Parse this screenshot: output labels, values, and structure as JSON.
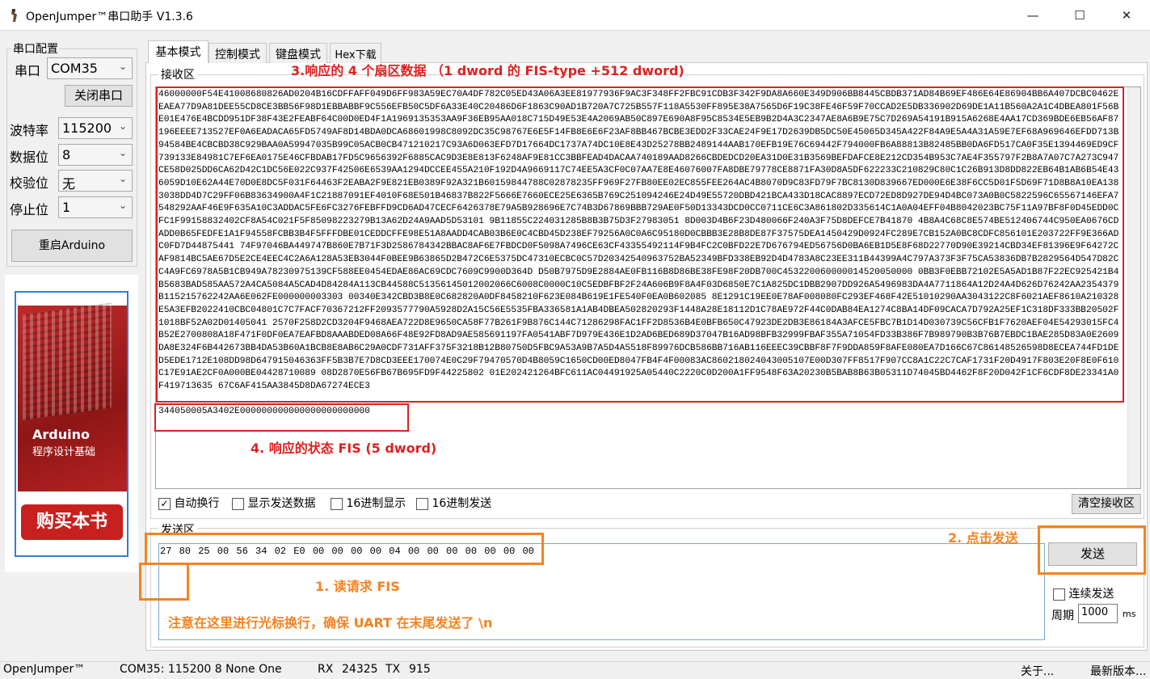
{
  "window": {
    "title": "OpenJumper™串口助手  V1.3.6",
    "controls": {
      "minimize": "—",
      "maximize": "☐",
      "close": "✕"
    }
  },
  "left_panel": {
    "group_title": "串口配置",
    "port_label": "串口",
    "port_value": "COM35",
    "close_port_button": "关闭串口",
    "baud_label": "波特率",
    "baud_value": "115200",
    "databits_label": "数据位",
    "databits_value": "8",
    "parity_label": "校验位",
    "parity_value": "无",
    "stopbits_label": "停止位",
    "stopbits_value": "1",
    "restart_button": "重启Arduino",
    "ad": {
      "book_title": "Arduino",
      "book_subtitle": "程序设计基础",
      "buy_button": "购买本书"
    }
  },
  "tabs": [
    {
      "label": "基本模式",
      "active": true
    },
    {
      "label": "控制模式",
      "active": false
    },
    {
      "label": "键盘模式",
      "active": false
    },
    {
      "label": "Hex下载",
      "active": false
    }
  ],
  "receive": {
    "group_title": "接收区",
    "hex_data": "46000000F54E41008680826AD0204B16CDFFAFF049D6FF983A59EC70A4DF782C05ED43A06A3EE81977936F9AC3F348FF2FBC91CDB3F342F9DA8A660E349D906BB8445CBDB371AD84B69EF486E64E86904BB6A407DCBC0462EEAEA77D9A81DEE55CD8CE3BB56F98D1EBBABBF9C556EFB50C5DF6A33E40C20486D6F1863C90AD1B720A7C725B557F118A5530FF895E38A7565D6F19C38FE46F59F70CCAD2E5DB336902D69DE1A11B560A2A1C4DBEA801F56BE01E476E4BCDD951DF38F43E2FEABF64C00D0ED4F1A1969135353AA9F36EB95AA018C715D49E53E4A2069AB50C897E690A8F95C8534E5EB9B2D4A3C2347AE8A6B9E75C7D269A54191B915A6268E4AA17CD369BDE6EB56AF87196EEEE713527EF0A6EADACA65FD5749AF8D14BDA0DCA68601998C8092DC35C98767E6E5F14FB8E6E6F23AF8BB467BCBE3EDD2F33CAE24F9E17D2639DB5DC50E45065D345A422F84A9E5A4A31A59E7EF68A969646EFDD713B94584BE4CBCBD38C929BAA0A59947035B99C05ACB0CB471210217C93A6D063EFD7D17664DC1737A74DC10E8E43D25278BB2489144AAB170EFB19E76C69442F794000FB6A88813B82485BB0DA6FD517CA0F35E1394469ED9CF739133E84981C7EF6EA0175E46CFBDAB17FD5C9656392F6885CAC9D3E8E813F6248AF9E81CC3BBFEAD4DACAA740189AAD8266CBDEDCD20EA31D0E31B3569BEFDAFCE8E212CD354B953C7AE4F355797F2B8A7A07C7A273C947CE58D025DD6CA62D42C1DC56E022C937F42506E6539AA1294DCCEE455A210F192D4A9669117C74EE5A3CF0C07AA7E8E46076007FA8DBE79778CE8871FA30D8A5DF622233C210829C80C1C26B913D8DD822EB64B1AB6B54E436059D10E62A44E70D0E8DC5F031F64463F2EABA2F9E821EB0389F92A321B60159844788C02878235FF969F27FB80EE02EC855FEE264AC4B8070D9C83FD79F7BC8130D839667ED000E6E38F6CC5D01F5D69F71D8B8A10EA1383038DD4D7C29FF06B83634900A4F1C21887091EF4010F68E501B46837B822F5666E7660ECE25E6365B769C251094246E24D49E55720DBD421BCA433D18CAC8897ECD72ED8D927DE94D4BC073A0B0C5822596C65567146EFA7548292AAF46E9F635A10C3ADDAC5FE6FC3276FEBFFD9CD6AD47CECF6426378E79A5B928696E7C74B3D67869BBB729AE0F50D13343DCD0CC0711CE6C3A861802D335614C1A0A04EFF04B8042023BC75F11A97BF8F0D45EDD0CFC1F99158832402CF8A54C021F5F85098223279B13A62D24A9AAD5D53101 9B11855C224031285B8B3B75D3F27983051 8D003D4B6F23D480066F240A3F75D8DEFCE7B41870 4B8A4C68C8E574BE512406744C950EA0676CDADD0B65FEDFE1A1F94558FCBB3B4F5FFFDBE01CEDDCFFE98E51A8AADD4CAB03B6E0C4CBD45D238EF79256A0C0A6C95180D0CBBB3E28B8DE87F37575DEA1450429D0924FC289E7CB152A0BC8CDFC856101E203722FF9E366ADC0FD7D44875441 74F97046BA449747B860E7B71F3D2586784342BBAC8AF6E7FBDCD0F5098A7496CE63CF43355492114F9B4FC2C0BFD22E7D676794ED56756D0BA6EB1D5E8F68D22770D90E39214CBD34EF81396E9F64272CAF9814BC5AE67D5E2CE4EEC4C2A6A128A53EB3044F0BEE9B63865D2B472C6E5375DC47310ECBC0C57D20342540963752BA52349BFD338EB92D4D4783A8C23EE311B44399A4C797A373F3F75CA53836DB7B2829564D547D82CC4A9FC6978A5B1CB949A78230975139CF588EE0454EDAE86AC69CDC7609C9900D364D D50B7975D9E2884AE0FB116B8D86BE38FE98F20DB700C453220060000014520050000 0BB3F0EBB72102E5A5AD1B87F22EC925421B4B5683BAD585AA572A4CA5084A5CAD4D84284A113CB44588C51356145012002066C6008C0000C10C5EDBFBF2F24A606B9F8A4F03D6850E7C1A825DC1DBB2907DD926A5496983DA4A7711864A12D24A4D626D76242AA2354379B115215762242AA6E062FE000000003303 00340E342CBD3B8E0C682820A0DF8458210F623E084B619E1FE540F0EA0B602085 8E1291C19EE0E78AF008080FC293EF468F42E51010290AA3043122C8F6021AEF8610A210328E5A3EFB2022410CBC04801C7C7FACF70367212FF2093577790A5928D2A15C56E5535FBA336581A1AB4DBEA502820293F1448A28E18112D1C78AE972F44C0DAB84EA1274C8BA14DF09CACA7D792A25EF1C318DF333BB20502F1018BF52A02D01405041 2570F258D2CD3204F9468AEA722D8E9650CA58F77B261F9B876C144C71286298FAC1FF2D8536B4E0BFB650C47923DE2DB3E86184A3AFCE5FBC7B1D14D030739C56CFB1F7620AEF04E54293015FC4B52E2700808A18F471F0DF0EA7EAFBD8AAABDED08A66F48E92FD8AD9AE585691197FA0541ABF7D979E436E1D2AD6BED689D37047B16AD98BFB32999FBAF355A71054FD33B386F7B989790B3B76B7EBDC1BAE285D83A0E2609DA8E324F6B442673BB4DA53B60A1BCB8E8AB6C29A0CDF731AFF375F3218B12B80750D5FBC9A53A9B7A5D4A5518F89976DCB586BB716AB116EEEC39CBBF8F7F9DDA859F8AFE080EA7D166C67C86148526598D8ECEA744FD1DED5EDE1712E108DD98D647915046363FF5B3B7E7D8CD3EEE170074E0C29F79470570D4B8059C1650CD00ED8047FB4F4F00083AC860218024043005107E00D307FF8517F907CC8A1C22C7CAF1731F20D4917F803E20F8E0F610C17E91AE2CF0A000BE04428710089 08D2870E56FB67B695FD9F44225802 01E202421264BFC611AC04491925A05440C2220C0D200A1FF9548F63A20230B5BAB8B63B05311D74045BD4462F8F20D042F1CF6CDF8DE23341A0F419713635 67C6AF415AA3845D8DA67274ECE3",
    "status_fis": "344050005A3402E000000000000000000000000",
    "annotation_data": "3.响应的 4 个扇区数据  （1 dword 的 FIS-type +512 dword)",
    "annotation_fis": "4. 响应的状态 FIS (5 dword)",
    "options": [
      {
        "label": "自动换行",
        "checked": true
      },
      {
        "label": "显示发送数据",
        "checked": false
      },
      {
        "label": "16进制显示",
        "checked": false
      },
      {
        "label": "16进制发送",
        "checked": false
      }
    ],
    "clear_button": "清空接收区"
  },
  "send": {
    "group_title": "发送区",
    "text": "27 80 25 00 56 34 02 E0 00 00 00 00 04 00 00 00 00 00 00 00",
    "send_button": "发送",
    "continuous_label": "连续发送",
    "continuous_checked": false,
    "period_label": "周期",
    "period_value": "1000",
    "period_unit": "ms",
    "annotation_read": "1. 读请求 FIS",
    "annotation_click": "2. 点击发送",
    "annotation_note": "注意在这里进行光标换行，确保 UART 在末尾发送了 \\n"
  },
  "statusbar": {
    "brand": "OpenJumper™",
    "port_info": "COM35: 115200 8 None One",
    "rx_label": "RX",
    "rx_value": "24325",
    "tx_label": "TX",
    "tx_value": "915",
    "about": "关于...",
    "latest": "最新版本..."
  },
  "colors": {
    "annotation_red": "#e02020",
    "annotation_orange": "#f58220",
    "ad_border": "#2f7fd0",
    "buy_button": "#c8201f"
  }
}
